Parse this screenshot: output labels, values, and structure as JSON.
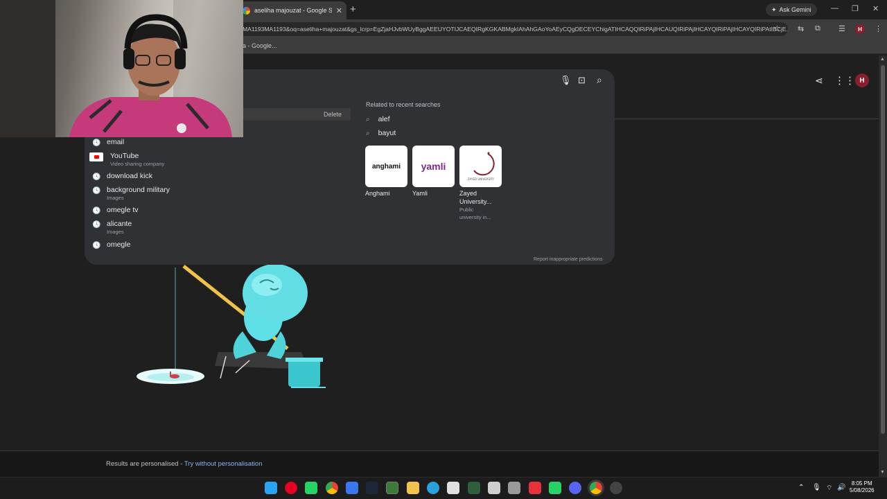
{
  "browser": {
    "tab_title": "aseliha majouzat - Google Search",
    "tab_close": "✕",
    "new_tab": "+",
    "ask_gemini": "Ask Gemini",
    "omnibox_url": "MA1193MA1193&oq=aseliha+majouzat&gs_lcrp=EgZjaHJvbWUyBggAEEUYOTIJCAEQIRgKGKABMgkIAhAhGAoYoAEyCQgDECEYChigATIHCAQQIRiPAjIHCAUQIRiPAjIHCAYQIRiPAjIHCAYQIRiPAtIBCjE...",
    "bookmark": "a - Google...",
    "profile_initial": "H"
  },
  "page": {
    "profile_initial": "H",
    "hover_delete": "Delete",
    "suggestions": [
      {
        "text": "email",
        "sub": ""
      },
      {
        "text": "YouTube",
        "sub": "Video sharing company"
      },
      {
        "text": "download kick",
        "sub": ""
      },
      {
        "text": "background military",
        "sub": "Images"
      },
      {
        "text": "omegle tv",
        "sub": ""
      },
      {
        "text": "alicante",
        "sub": "Images"
      },
      {
        "text": "omegle",
        "sub": ""
      }
    ],
    "related_heading": "Related to recent searches",
    "related": [
      "alef",
      "bayut"
    ],
    "cards": [
      {
        "title1": "Anghami",
        "title2": "",
        "sub1": "",
        "sub2": "",
        "logo": "anghami"
      },
      {
        "title1": "Yamli",
        "title2": "",
        "sub1": "",
        "sub2": "",
        "logo": "yamli"
      },
      {
        "title1": "Zayed",
        "title2": "University...",
        "sub1": "Public",
        "sub2": "university in...",
        "logo": "ZAYED UNIVERSITY"
      }
    ],
    "report": "Report inappropriate predictions"
  },
  "footer": {
    "text": "Results are personalised - ",
    "link": "Try without personalisation"
  },
  "taskbar": {
    "time": "8:05 PM",
    "date": "5/08/2026",
    "apps": [
      "windows-start",
      "pinterest",
      "whatsapp",
      "chrome",
      "signal",
      "steam",
      "terminal",
      "file-explorer",
      "telegram",
      "store",
      "code",
      "tasks",
      "printer",
      "anydesk",
      "whatsapp-2",
      "discord",
      "chrome-active",
      "settings"
    ]
  },
  "colors": {
    "accent_link": "#8ab4f8",
    "panel": "#303134",
    "background": "#1f1f1f",
    "profile": "#8a1f2b"
  }
}
